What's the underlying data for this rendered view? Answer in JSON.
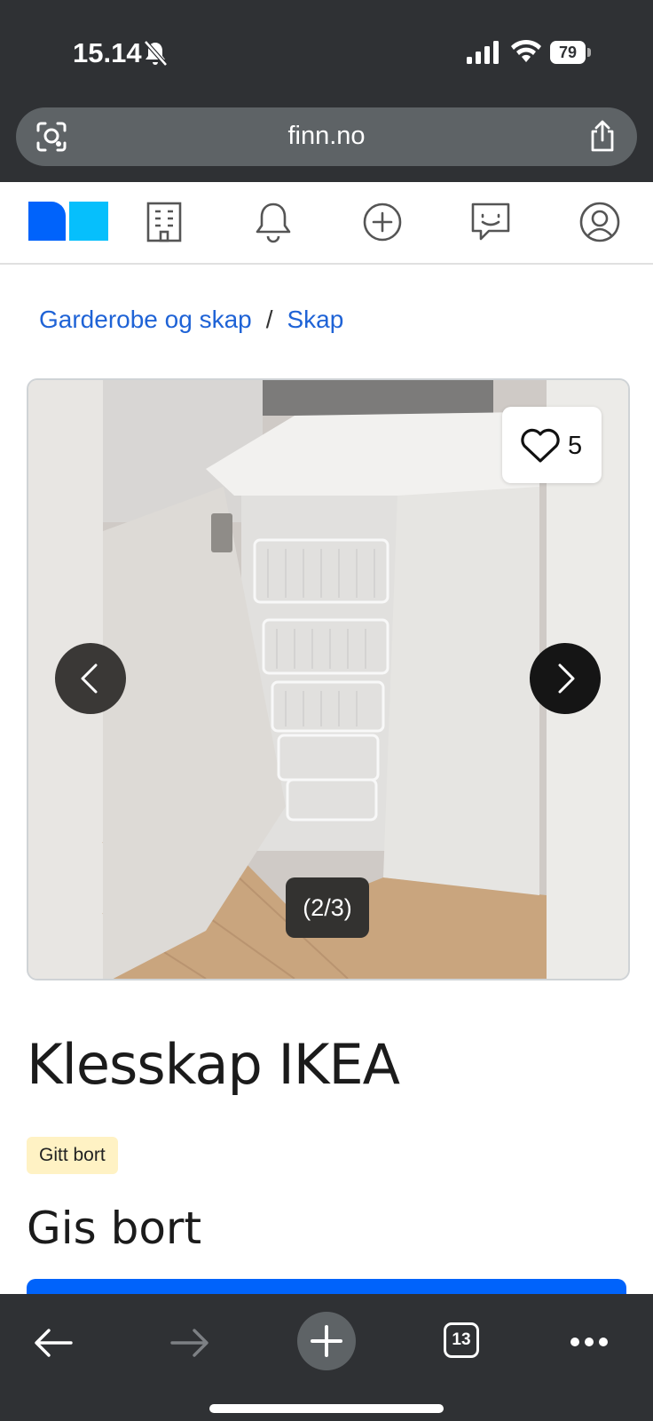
{
  "status_bar": {
    "time": "15.14",
    "battery": "79"
  },
  "browser": {
    "url": "finn.no"
  },
  "breadcrumb": {
    "items": [
      "Garderobe og skap",
      "Skap"
    ],
    "separator": "/"
  },
  "gallery": {
    "favorites_count": "5",
    "counter": "(2/3)"
  },
  "listing": {
    "title": "Klesskap IKEA",
    "badge": "Gitt bort",
    "price": "Gis bort"
  },
  "bottom_bar": {
    "tab_count": "13"
  },
  "colors": {
    "accent": "#0063fb",
    "link": "#1f63d6",
    "badge_bg": "#fff2c4",
    "chrome": "#2f3134"
  }
}
